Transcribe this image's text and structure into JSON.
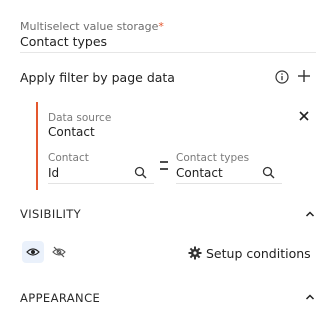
{
  "multiselect": {
    "label": "Multiselect value storage",
    "required_marker": "*",
    "value": "Contact types"
  },
  "filter": {
    "title": "Apply filter by page data",
    "data_source_label": "Data source",
    "data_source_value": "Contact",
    "left_label": "Contact",
    "left_value": "Id",
    "operator": "=",
    "right_label": "Contact types",
    "right_value": "Contact"
  },
  "visibility": {
    "title": "VISIBILITY",
    "setup_label": "Setup conditions"
  },
  "appearance": {
    "title": "APPEARANCE"
  },
  "colors": {
    "accent": "#e4572e",
    "selected_bg": "#eaf1fb"
  }
}
